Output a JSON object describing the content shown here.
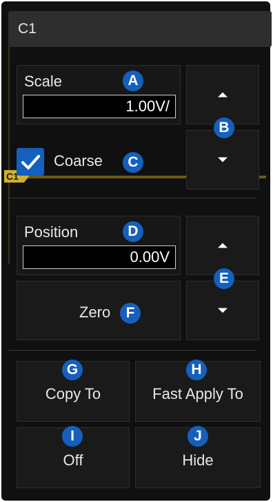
{
  "menu": {
    "title": "C1"
  },
  "scale": {
    "label": "Scale",
    "value": "1.00V/"
  },
  "coarse": {
    "label": "Coarse",
    "checked": true
  },
  "position": {
    "label": "Position",
    "value": "0.00V"
  },
  "zero_label": "Zero",
  "buttons": {
    "copy_to": "Copy To",
    "fast_apply_to": "Fast Apply To",
    "off": "Off",
    "hide": "Hide"
  },
  "trace_label": "C1",
  "badges": [
    "A",
    "B",
    "C",
    "D",
    "E",
    "F",
    "G",
    "H",
    "I",
    "J"
  ],
  "colors": {
    "accent": "#1560bd",
    "trace": "#d2b02c",
    "background": "#101010"
  }
}
